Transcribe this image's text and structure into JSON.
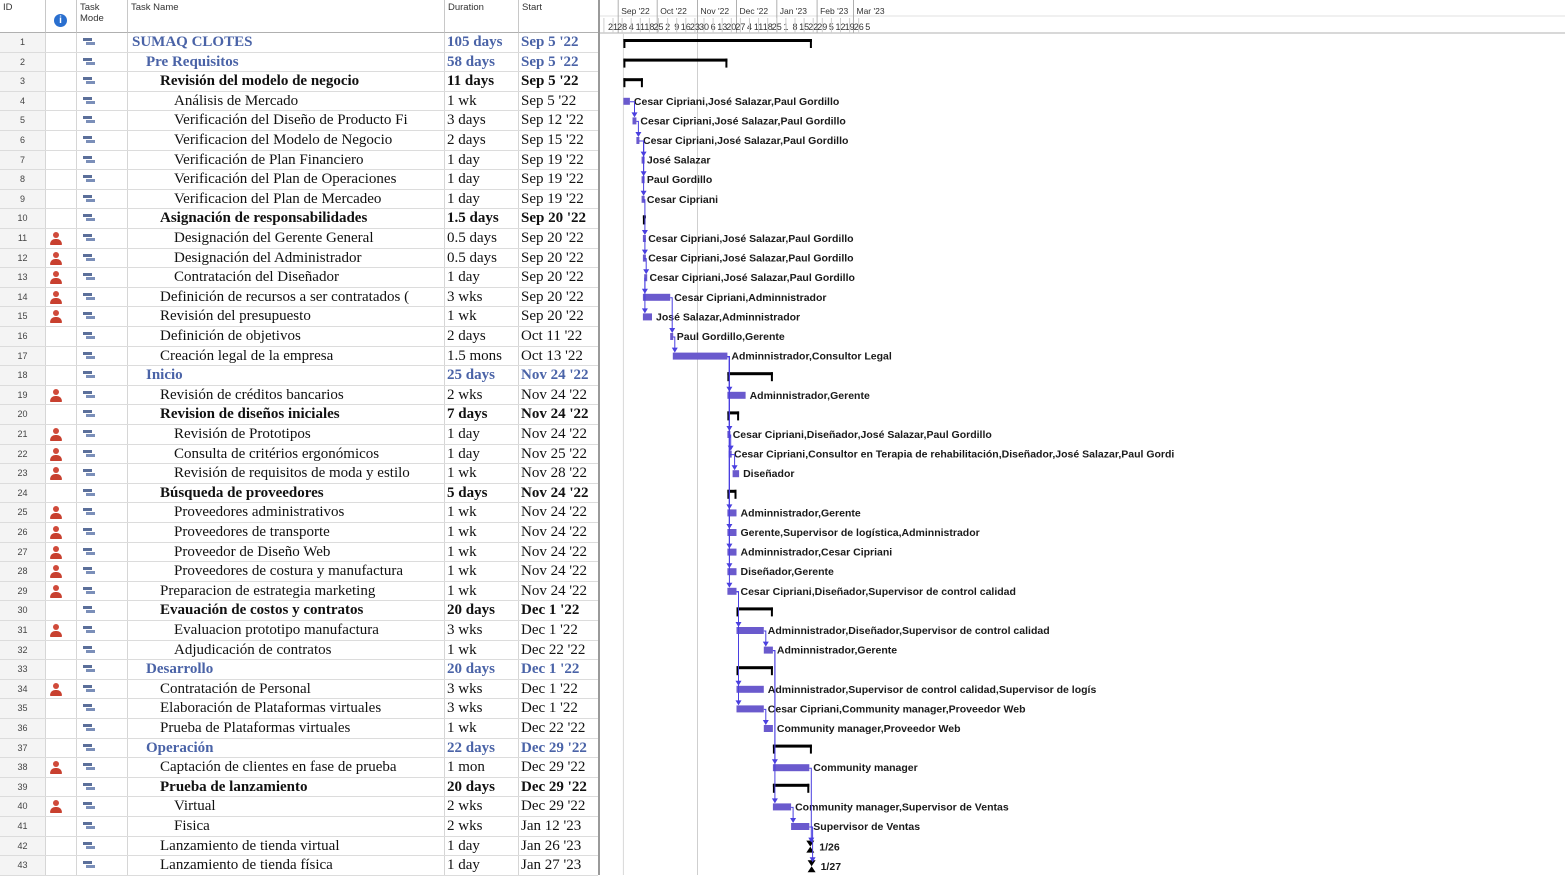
{
  "columns": {
    "id": "ID",
    "task_mode": "Task Mode",
    "task_name": "Task Name",
    "duration": "Duration",
    "start": "Start"
  },
  "colors": {
    "task_bar": "#6a5acd",
    "summary_bar": "#000000",
    "link": "#4a3fe0",
    "today_line": "#c8c8c8",
    "summary_text": "#4a63a7"
  },
  "timescale": {
    "months": [
      {
        "label": "Sep '22",
        "date": "2022-09-01"
      },
      {
        "label": "Oct '22",
        "date": "2022-10-01"
      },
      {
        "label": "Nov '22",
        "date": "2022-11-01"
      },
      {
        "label": "Dec '22",
        "date": "2022-12-01"
      },
      {
        "label": "Jan '23",
        "date": "2023-01-01"
      },
      {
        "label": "Feb '23",
        "date": "2023-02-01"
      },
      {
        "label": "Mar '23",
        "date": "2023-03-01"
      }
    ],
    "weeks": [
      "21",
      "28",
      "4",
      "11",
      "18",
      "25",
      "2",
      "9",
      "16",
      "23",
      "30",
      "6",
      "13",
      "20",
      "27",
      "4",
      "11",
      "18",
      "25",
      "1",
      "8",
      "15",
      "22",
      "29",
      "5",
      "12",
      "19",
      "26",
      "5"
    ]
  },
  "tasks": [
    {
      "id": "1",
      "name": "SUMAQ CLOTES",
      "duration": "105 days",
      "start": "Sep 5 '22",
      "level": 0,
      "summary": true,
      "res_icon": false,
      "bar": {
        "type": "summary",
        "start": "2022-09-05",
        "end": "2023-01-27"
      },
      "label": ""
    },
    {
      "id": "2",
      "name": "Pre Requisitos",
      "duration": "58 days",
      "start": "Sep 5 '22",
      "level": 1,
      "summary": true,
      "res_icon": false,
      "bar": {
        "type": "summary",
        "start": "2022-09-05",
        "end": "2022-11-23"
      },
      "label": ""
    },
    {
      "id": "3",
      "name": "Revisión del modelo de negocio",
      "duration": "11 days",
      "start": "Sep 5 '22",
      "level": 2,
      "summary": true,
      "res_icon": false,
      "bar": {
        "type": "summary",
        "start": "2022-09-05",
        "end": "2022-09-19"
      },
      "label": ""
    },
    {
      "id": "4",
      "name": "Análisis de Mercado",
      "duration": "1 wk",
      "start": "Sep 5 '22",
      "level": 3,
      "summary": false,
      "res_icon": false,
      "bar": {
        "type": "task",
        "start": "2022-09-05",
        "end": "2022-09-09"
      },
      "label": "Cesar Cipriani,José Salazar,Paul Gordillo"
    },
    {
      "id": "5",
      "name": "Verificación del Diseño de Producto Fi",
      "duration": "3 days",
      "start": "Sep 12 '22",
      "level": 3,
      "summary": false,
      "res_icon": false,
      "bar": {
        "type": "task",
        "start": "2022-09-12",
        "end": "2022-09-14"
      },
      "label": "Cesar Cipriani,José Salazar,Paul Gordillo"
    },
    {
      "id": "6",
      "name": "Verificacion del Modelo de Negocio",
      "duration": "2 days",
      "start": "Sep 15 '22",
      "level": 3,
      "summary": false,
      "res_icon": false,
      "bar": {
        "type": "task",
        "start": "2022-09-15",
        "end": "2022-09-16"
      },
      "label": "Cesar Cipriani,José Salazar,Paul Gordillo"
    },
    {
      "id": "7",
      "name": "Verificación de Plan Financiero",
      "duration": "1 day",
      "start": "Sep 19 '22",
      "level": 3,
      "summary": false,
      "res_icon": false,
      "bar": {
        "type": "task",
        "start": "2022-09-19",
        "end": "2022-09-19"
      },
      "label": "José Salazar"
    },
    {
      "id": "8",
      "name": "Verificación del Plan de Operaciones",
      "duration": "1 day",
      "start": "Sep 19 '22",
      "level": 3,
      "summary": false,
      "res_icon": false,
      "bar": {
        "type": "task",
        "start": "2022-09-19",
        "end": "2022-09-19"
      },
      "label": "Paul Gordillo"
    },
    {
      "id": "9",
      "name": "Verificacion del Plan de Mercadeo",
      "duration": "1 day",
      "start": "Sep 19 '22",
      "level": 3,
      "summary": false,
      "res_icon": false,
      "bar": {
        "type": "task",
        "start": "2022-09-19",
        "end": "2022-09-19"
      },
      "label": "Cesar Cipriani"
    },
    {
      "id": "10",
      "name": "Asignación de responsabilidades",
      "duration": "1.5 days",
      "start": "Sep 20 '22",
      "level": 2,
      "summary": true,
      "res_icon": false,
      "bar": {
        "type": "summary",
        "start": "2022-09-20",
        "end": "2022-09-21"
      },
      "label": ""
    },
    {
      "id": "11",
      "name": "Designación del Gerente General",
      "duration": "0.5 days",
      "start": "Sep 20 '22",
      "level": 3,
      "summary": false,
      "res_icon": true,
      "bar": {
        "type": "task",
        "start": "2022-09-20",
        "end": "2022-09-20"
      },
      "label": "Cesar Cipriani,José Salazar,Paul Gordillo"
    },
    {
      "id": "12",
      "name": "Designación del Administrador",
      "duration": "0.5 days",
      "start": "Sep 20 '22",
      "level": 3,
      "summary": false,
      "res_icon": true,
      "bar": {
        "type": "task",
        "start": "2022-09-20",
        "end": "2022-09-20"
      },
      "label": "Cesar Cipriani,José Salazar,Paul Gordillo"
    },
    {
      "id": "13",
      "name": "Contratación del Diseñador",
      "duration": "1 day",
      "start": "Sep 20 '22",
      "level": 3,
      "summary": false,
      "res_icon": true,
      "bar": {
        "type": "task",
        "start": "2022-09-21",
        "end": "2022-09-21"
      },
      "label": "Cesar Cipriani,José Salazar,Paul Gordillo"
    },
    {
      "id": "14",
      "name": "Definición de recursos a ser contratados (",
      "duration": "3 wks",
      "start": "Sep 20 '22",
      "level": 2,
      "summary": false,
      "res_icon": true,
      "bar": {
        "type": "task",
        "start": "2022-09-20",
        "end": "2022-10-10"
      },
      "label": "Cesar Cipriani,Adminnistrador"
    },
    {
      "id": "15",
      "name": "Revisión del presupuesto",
      "duration": "1 wk",
      "start": "Sep 20 '22",
      "level": 2,
      "summary": false,
      "res_icon": true,
      "bar": {
        "type": "task",
        "start": "2022-09-20",
        "end": "2022-09-26"
      },
      "label": "José Salazar,Adminnistrador"
    },
    {
      "id": "16",
      "name": "Definición de objetivos",
      "duration": "2 days",
      "start": "Oct 11 '22",
      "level": 2,
      "summary": false,
      "res_icon": false,
      "bar": {
        "type": "task",
        "start": "2022-10-11",
        "end": "2022-10-12"
      },
      "label": "Paul Gordillo,Gerente"
    },
    {
      "id": "17",
      "name": "Creación legal de la empresa",
      "duration": "1.5 mons",
      "start": "Oct 13 '22",
      "level": 2,
      "summary": false,
      "res_icon": false,
      "bar": {
        "type": "task",
        "start": "2022-10-13",
        "end": "2022-11-23"
      },
      "label": "Adminnistrador,Consultor Legal"
    },
    {
      "id": "18",
      "name": "Inicio",
      "duration": "25 days",
      "start": "Nov 24 '22",
      "level": 1,
      "summary": true,
      "res_icon": false,
      "bar": {
        "type": "summary",
        "start": "2022-11-24",
        "end": "2022-12-28"
      },
      "label": ""
    },
    {
      "id": "19",
      "name": "Revisión de créditos bancarios",
      "duration": "2 wks",
      "start": "Nov 24 '22",
      "level": 2,
      "summary": false,
      "res_icon": true,
      "bar": {
        "type": "task",
        "start": "2022-11-24",
        "end": "2022-12-07"
      },
      "label": "Adminnistrador,Gerente"
    },
    {
      "id": "20",
      "name": "Revision de diseños iniciales",
      "duration": "7 days",
      "start": "Nov 24 '22",
      "level": 2,
      "summary": true,
      "res_icon": false,
      "bar": {
        "type": "summary",
        "start": "2022-11-24",
        "end": "2022-12-02"
      },
      "label": ""
    },
    {
      "id": "21",
      "name": "Revisión de Prototipos",
      "duration": "1 day",
      "start": "Nov 24 '22",
      "level": 3,
      "summary": false,
      "res_icon": true,
      "bar": {
        "type": "task",
        "start": "2022-11-24",
        "end": "2022-11-24"
      },
      "label": "Cesar Cipriani,Diseñador,José Salazar,Paul Gordillo"
    },
    {
      "id": "22",
      "name": "Consulta de critérios ergonómicos",
      "duration": "1 day",
      "start": "Nov 25 '22",
      "level": 3,
      "summary": false,
      "res_icon": true,
      "bar": {
        "type": "task",
        "start": "2022-11-25",
        "end": "2022-11-25"
      },
      "label": "Cesar Cipriani,Consultor en Terapia de rehabilitación,Diseñador,José Salazar,Paul Gordi"
    },
    {
      "id": "23",
      "name": "Revisión de requisitos de moda y estilo",
      "duration": "1 wk",
      "start": "Nov 28 '22",
      "level": 3,
      "summary": false,
      "res_icon": true,
      "bar": {
        "type": "task",
        "start": "2022-11-28",
        "end": "2022-12-02"
      },
      "label": "Diseñador"
    },
    {
      "id": "24",
      "name": "Búsqueda de proveedores",
      "duration": "5 days",
      "start": "Nov 24 '22",
      "level": 2,
      "summary": true,
      "res_icon": false,
      "bar": {
        "type": "summary",
        "start": "2022-11-24",
        "end": "2022-11-30"
      },
      "label": ""
    },
    {
      "id": "25",
      "name": "Proveedores administrativos",
      "duration": "1 wk",
      "start": "Nov 24 '22",
      "level": 3,
      "summary": false,
      "res_icon": true,
      "bar": {
        "type": "task",
        "start": "2022-11-24",
        "end": "2022-11-30"
      },
      "label": "Adminnistrador,Gerente"
    },
    {
      "id": "26",
      "name": "Proveedores de transporte",
      "duration": "1 wk",
      "start": "Nov 24 '22",
      "level": 3,
      "summary": false,
      "res_icon": true,
      "bar": {
        "type": "task",
        "start": "2022-11-24",
        "end": "2022-11-30"
      },
      "label": "Gerente,Supervisor de logística,Adminnistrador"
    },
    {
      "id": "27",
      "name": "Proveedor de Diseño Web",
      "duration": "1 wk",
      "start": "Nov 24 '22",
      "level": 3,
      "summary": false,
      "res_icon": true,
      "bar": {
        "type": "task",
        "start": "2022-11-24",
        "end": "2022-11-30"
      },
      "label": "Adminnistrador,Cesar Cipriani"
    },
    {
      "id": "28",
      "name": "Proveedores de costura y manufactura",
      "duration": "1 wk",
      "start": "Nov 24 '22",
      "level": 3,
      "summary": false,
      "res_icon": true,
      "bar": {
        "type": "task",
        "start": "2022-11-24",
        "end": "2022-11-30"
      },
      "label": "Diseñador,Gerente"
    },
    {
      "id": "29",
      "name": "Preparacion de estrategia marketing",
      "duration": "1 wk",
      "start": "Nov 24 '22",
      "level": 2,
      "summary": false,
      "res_icon": true,
      "bar": {
        "type": "task",
        "start": "2022-11-24",
        "end": "2022-11-30"
      },
      "label": "Cesar Cipriani,Diseñador,Supervisor de control calidad"
    },
    {
      "id": "30",
      "name": "Evauación de costos y contratos",
      "duration": "20 days",
      "start": "Dec 1 '22",
      "level": 2,
      "summary": true,
      "res_icon": false,
      "bar": {
        "type": "summary",
        "start": "2022-12-01",
        "end": "2022-12-28"
      },
      "label": ""
    },
    {
      "id": "31",
      "name": "Evaluacion prototipo manufactura",
      "duration": "3 wks",
      "start": "Dec 1 '22",
      "level": 3,
      "summary": false,
      "res_icon": true,
      "bar": {
        "type": "task",
        "start": "2022-12-01",
        "end": "2022-12-21"
      },
      "label": "Adminnistrador,Diseñador,Supervisor de control calidad"
    },
    {
      "id": "32",
      "name": "Adjudicación de contratos",
      "duration": "1 wk",
      "start": "Dec 22 '22",
      "level": 3,
      "summary": false,
      "res_icon": false,
      "bar": {
        "type": "task",
        "start": "2022-12-22",
        "end": "2022-12-28"
      },
      "label": "Adminnistrador,Gerente"
    },
    {
      "id": "33",
      "name": "Desarrollo",
      "duration": "20 days",
      "start": "Dec 1 '22",
      "level": 1,
      "summary": true,
      "res_icon": false,
      "bar": {
        "type": "summary",
        "start": "2022-12-01",
        "end": "2022-12-28"
      },
      "label": ""
    },
    {
      "id": "34",
      "name": "Contratación de Personal",
      "duration": "3 wks",
      "start": "Dec 1 '22",
      "level": 2,
      "summary": false,
      "res_icon": true,
      "bar": {
        "type": "task",
        "start": "2022-12-01",
        "end": "2022-12-21"
      },
      "label": "Adminnistrador,Supervisor de control calidad,Supervisor de logís"
    },
    {
      "id": "35",
      "name": "Elaboración de Plataformas virtuales",
      "duration": "3 wks",
      "start": "Dec 1 '22",
      "level": 2,
      "summary": false,
      "res_icon": false,
      "bar": {
        "type": "task",
        "start": "2022-12-01",
        "end": "2022-12-21"
      },
      "label": "Cesar Cipriani,Community manager,Proveedor Web"
    },
    {
      "id": "36",
      "name": "Prueba de Plataformas virtuales",
      "duration": "1 wk",
      "start": "Dec 22 '22",
      "level": 2,
      "summary": false,
      "res_icon": false,
      "bar": {
        "type": "task",
        "start": "2022-12-22",
        "end": "2022-12-28"
      },
      "label": "Community manager,Proveedor Web"
    },
    {
      "id": "37",
      "name": "Operación",
      "duration": "22 days",
      "start": "Dec 29 '22",
      "level": 1,
      "summary": true,
      "res_icon": false,
      "bar": {
        "type": "summary",
        "start": "2022-12-29",
        "end": "2023-01-27"
      },
      "label": ""
    },
    {
      "id": "38",
      "name": "Captación de clientes en fase de prueba",
      "duration": "1 mon",
      "start": "Dec 29 '22",
      "level": 2,
      "summary": false,
      "res_icon": true,
      "bar": {
        "type": "task",
        "start": "2022-12-29",
        "end": "2023-01-25"
      },
      "label": "Community manager"
    },
    {
      "id": "39",
      "name": "Prueba de lanzamiento",
      "duration": "20 days",
      "start": "Dec 29 '22",
      "level": 2,
      "summary": true,
      "res_icon": false,
      "bar": {
        "type": "summary",
        "start": "2022-12-29",
        "end": "2023-01-25"
      },
      "label": ""
    },
    {
      "id": "40",
      "name": "Virtual",
      "duration": "2 wks",
      "start": "Dec 29 '22",
      "level": 3,
      "summary": false,
      "res_icon": true,
      "bar": {
        "type": "task",
        "start": "2022-12-29",
        "end": "2023-01-11"
      },
      "label": "Community manager,Supervisor de Ventas"
    },
    {
      "id": "41",
      "name": "Fisica",
      "duration": "2 wks",
      "start": "Jan 12 '23",
      "level": 3,
      "summary": false,
      "res_icon": false,
      "bar": {
        "type": "task",
        "start": "2023-01-12",
        "end": "2023-01-25"
      },
      "label": "Supervisor de Ventas"
    },
    {
      "id": "42",
      "name": "Lanzamiento de tienda virtual",
      "duration": "1 day",
      "start": "Jan 26 '23",
      "level": 2,
      "summary": false,
      "res_icon": false,
      "bar": {
        "type": "milestone",
        "start": "2023-01-26",
        "end": "2023-01-26"
      },
      "label": "1/26"
    },
    {
      "id": "43",
      "name": "Lanzamiento de tienda física",
      "duration": "1 day",
      "start": "Jan 27 '23",
      "level": 2,
      "summary": false,
      "res_icon": false,
      "bar": {
        "type": "milestone",
        "start": "2023-01-27",
        "end": "2023-01-27"
      },
      "label": "1/27"
    }
  ]
}
